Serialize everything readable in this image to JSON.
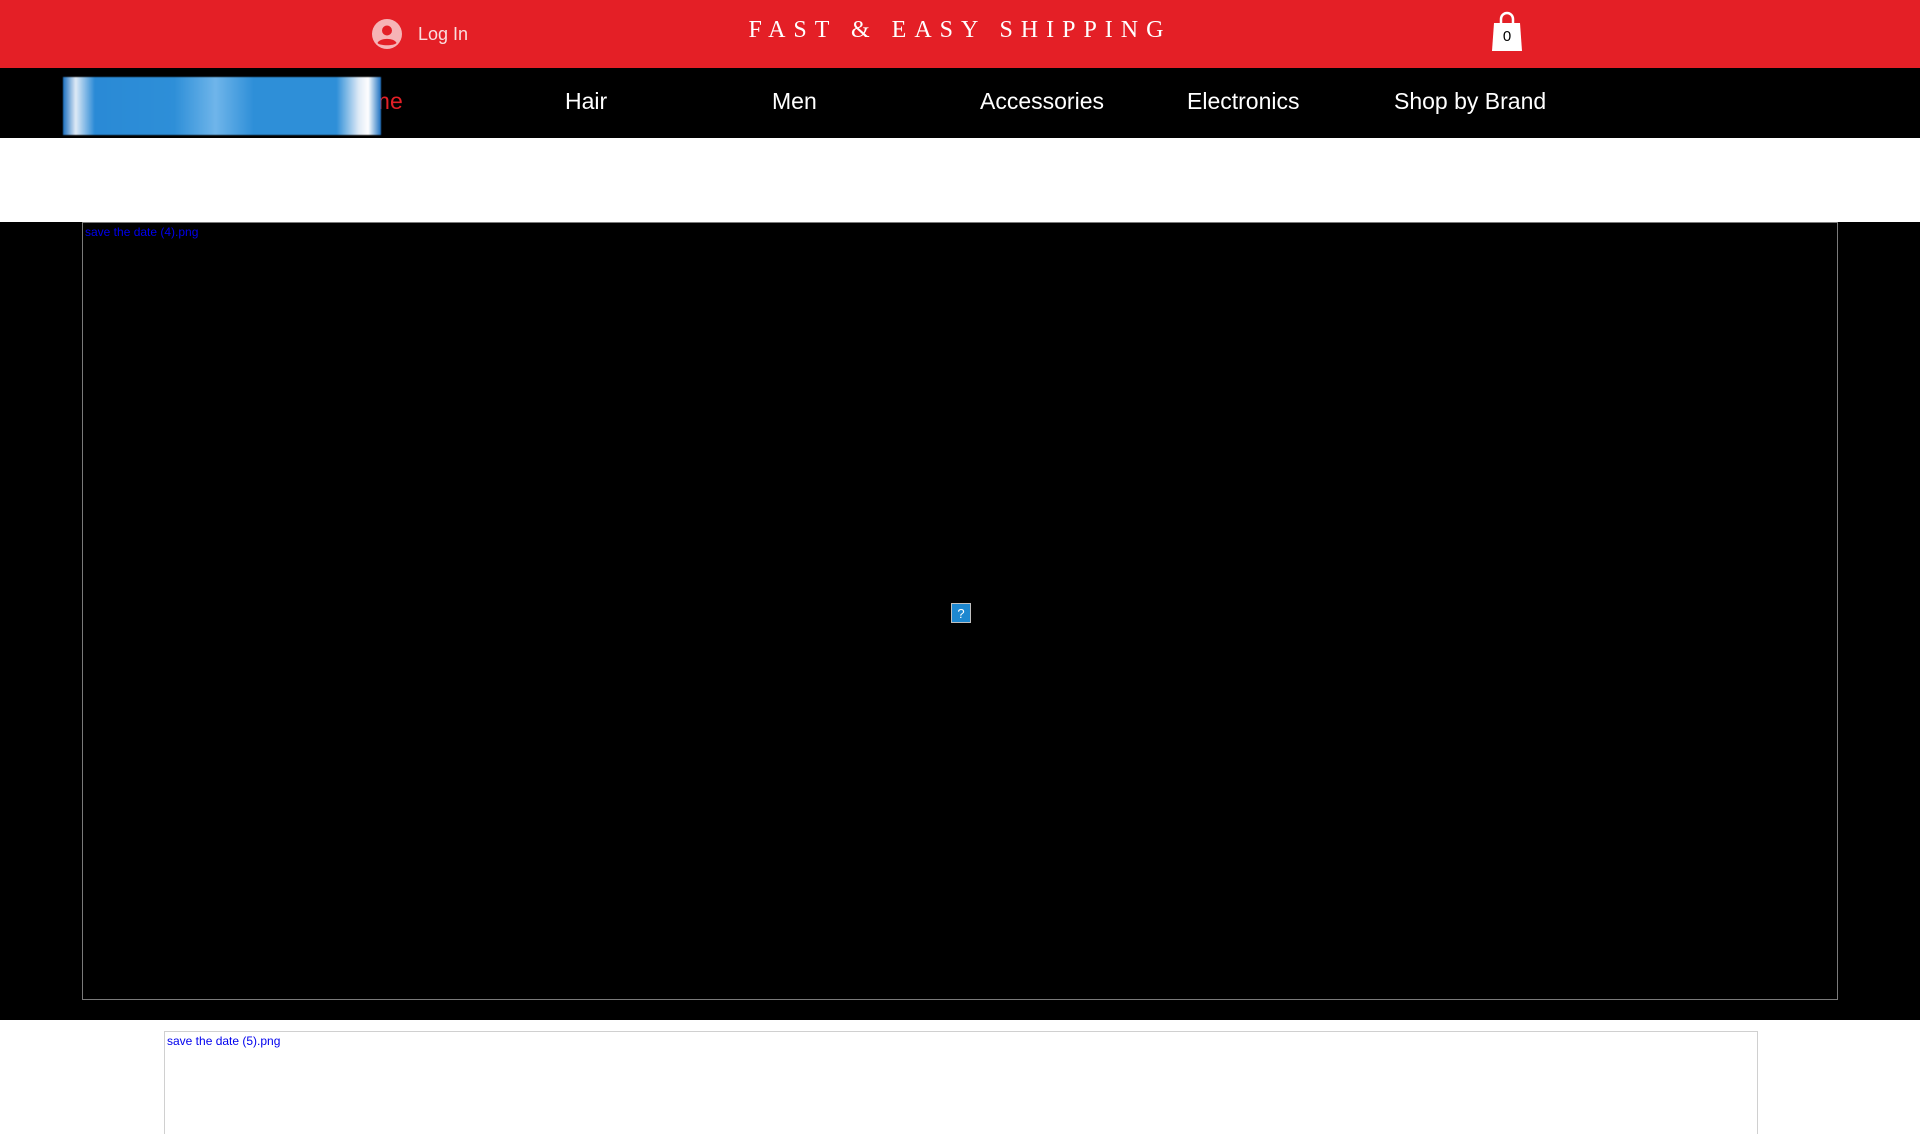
{
  "topbar": {
    "login_label": "Log In",
    "shipping_text": "FAST & EASY SHIPPING",
    "cart_count": "0",
    "accent_color": "#e41f26"
  },
  "nav": {
    "items": [
      {
        "label": "ome",
        "active": true
      },
      {
        "label": "Hair",
        "active": false
      },
      {
        "label": "Men",
        "active": false
      },
      {
        "label": "Accessories",
        "active": false
      },
      {
        "label": "Electronics",
        "active": false
      },
      {
        "label": "Shop by Brand",
        "active": false
      }
    ]
  },
  "hero": {
    "image_alt": "save the date (4).png",
    "broken_icon_glyph": "?"
  },
  "section2": {
    "image_alt": "save the date (5).png"
  },
  "icons": {
    "login": "user-avatar-icon",
    "cart": "shopping-bag-icon",
    "broken_image": "broken-image-icon"
  }
}
